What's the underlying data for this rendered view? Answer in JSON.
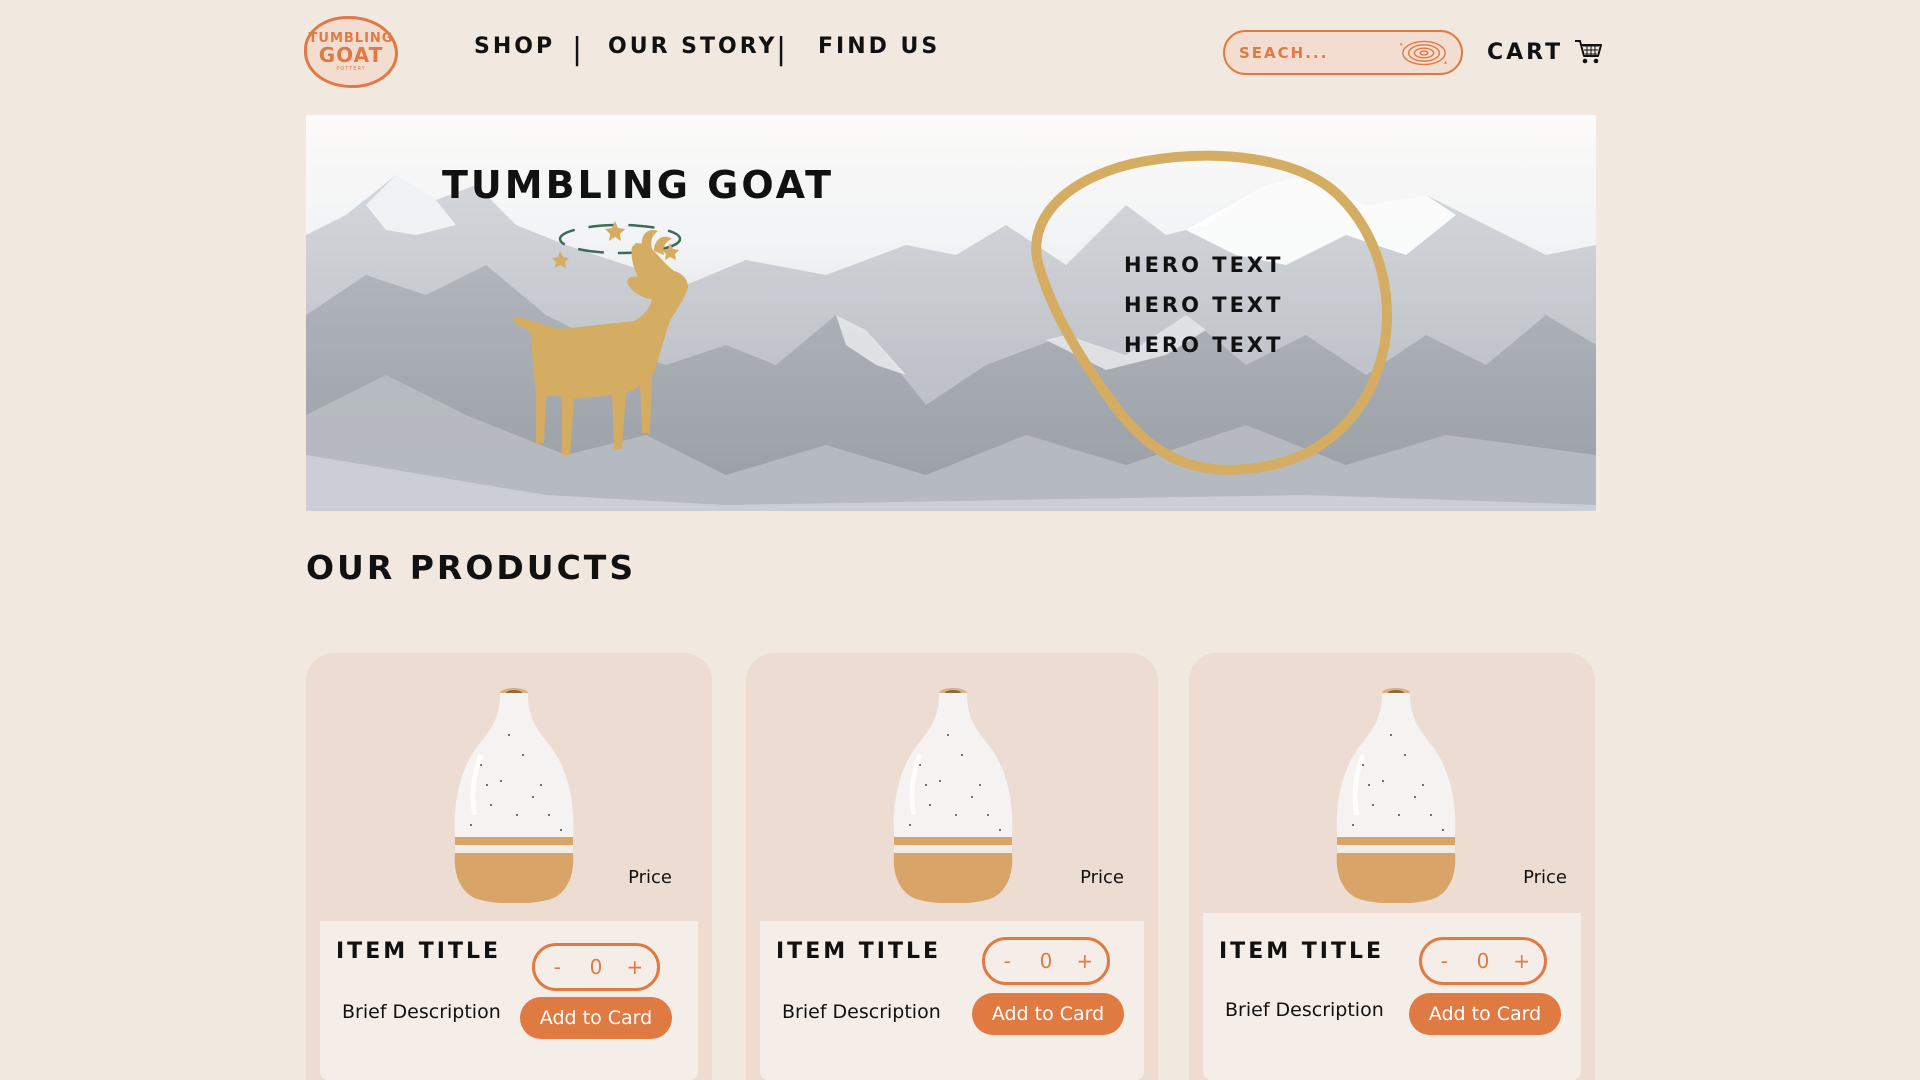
{
  "brand": {
    "logo_line1": "TUMBLING",
    "logo_line2": "GOAT",
    "logo_line3": "POTTERY"
  },
  "nav": {
    "items": [
      {
        "label": "SHOP"
      },
      {
        "label": "OUR STORY"
      },
      {
        "label": "FIND US"
      }
    ],
    "separator": "|"
  },
  "search": {
    "placeholder": "SEACH..."
  },
  "cart": {
    "label": "CART"
  },
  "hero": {
    "title": "TUMBLING GOAT",
    "lines": [
      "HERO TEXT",
      "HERO TEXT",
      "HERO TEXT"
    ]
  },
  "products_section": {
    "title": "OUR PRODUCTS"
  },
  "products": [
    {
      "title": "ITEM TITLE",
      "description": "Brief Description",
      "price": "Price",
      "quantity": "0",
      "minus": "-",
      "plus": "+",
      "add_label": "Add to Card"
    },
    {
      "title": "ITEM TITLE",
      "description": "Brief Description",
      "price": "Price",
      "quantity": "0",
      "minus": "-",
      "plus": "+",
      "add_label": "Add to Card"
    },
    {
      "title": "ITEM TITLE",
      "description": "Brief Description",
      "price": "Price",
      "quantity": "0",
      "minus": "-",
      "plus": "+",
      "add_label": "Add to Card"
    }
  ],
  "colors": {
    "background": "#f1e8df",
    "accent": "#e07a43",
    "gold": "#d4ad62",
    "card": "#ecdcd2"
  }
}
